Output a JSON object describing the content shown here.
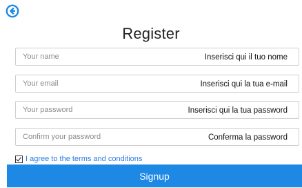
{
  "header": {
    "back_icon": "arrow-left-circle-icon",
    "title": "Register",
    "accent_color": "#1e88e5"
  },
  "form": {
    "name": {
      "placeholder": "Your name",
      "hint": "Inserisci qui il tuo nome"
    },
    "email": {
      "placeholder": "Your email",
      "hint": "Inserisci qui la tua e-mail"
    },
    "password": {
      "placeholder": "Your password",
      "hint": "Inserisci qui la tua password"
    },
    "confirm_password": {
      "placeholder": "Confirm your password",
      "hint": "Conferma la password"
    },
    "terms": {
      "checked": true,
      "label": "I agree to the terms and conditions"
    },
    "submit_label": "Signup"
  }
}
